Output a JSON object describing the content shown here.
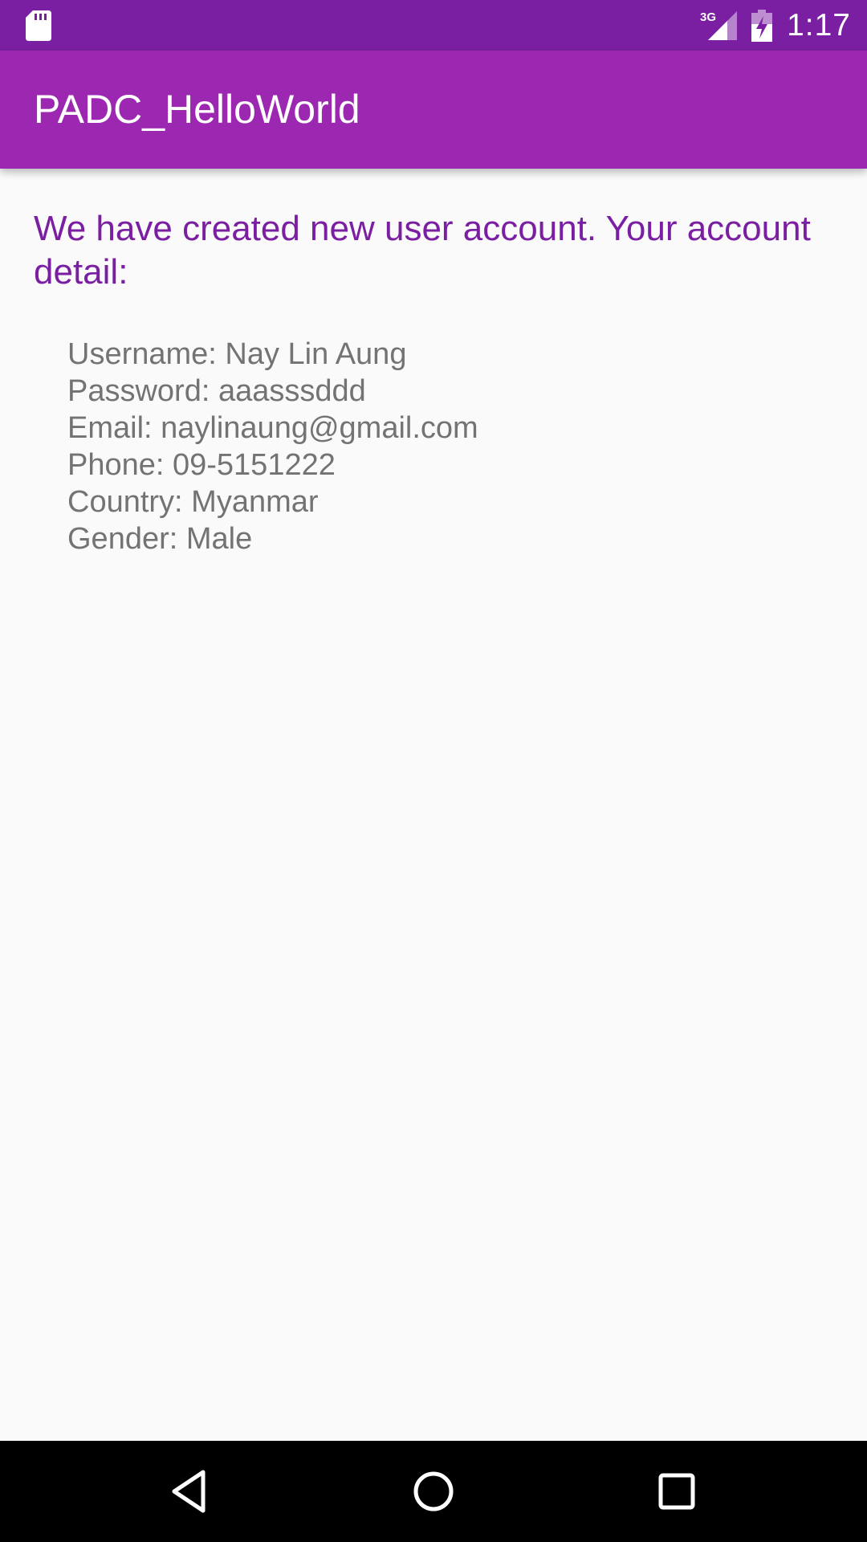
{
  "status_bar": {
    "time": "1:17",
    "network_label": "3G",
    "icons": [
      "sd-card-icon",
      "signal-3g-icon",
      "battery-charging-icon"
    ],
    "color": "#7b1fa2"
  },
  "app_bar": {
    "title": "PADC_HelloWorld",
    "color": "#9c27b0"
  },
  "content": {
    "headline": "We have created new user account. Your account detail:",
    "headline_color": "#7b1fa2",
    "details": [
      "Username: Nay Lin Aung",
      "Password: aaasssddd",
      "Email: naylinaung@gmail.com",
      "Phone: 09-5151222",
      "Country: Myanmar",
      "Gender: Male"
    ]
  },
  "nav_bar": {
    "buttons": [
      "back-icon",
      "home-icon",
      "recents-icon"
    ]
  }
}
